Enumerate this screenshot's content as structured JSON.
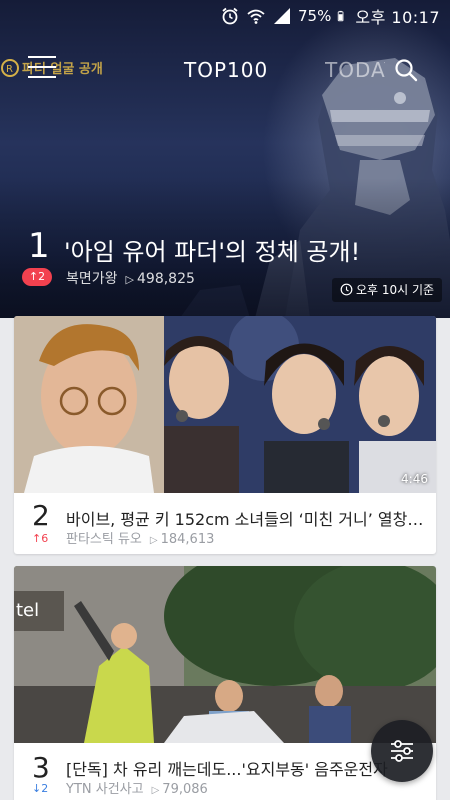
{
  "status_bar": {
    "battery": "75%",
    "time": "오후 10:17",
    "icons": [
      "alarm-icon",
      "wifi-icon",
      "signal-icon",
      "battery-icon"
    ]
  },
  "nav": {
    "brand": "파더 얼굴 공개",
    "tabs": [
      {
        "label": "TOP100",
        "active": true
      },
      {
        "label": "TODAY",
        "active": false
      }
    ],
    "icons": [
      "menu-icon",
      "search-icon"
    ]
  },
  "hero": {
    "rank": "1",
    "title": "'아임 유어 파더'의 정체 공개!",
    "change": "↑2",
    "program": "복면가왕",
    "views": "498,825",
    "updated": "오후 10시 기준"
  },
  "items": [
    {
      "rank": "2",
      "title": "바이브, 평균 키 152cm 소녀들의 ‘미친 거니’ 열창에 ...",
      "change": "↑6",
      "direction": "up",
      "program": "판타스틱 듀오",
      "views": "184,613",
      "duration": "4:46"
    },
    {
      "rank": "3",
      "title": "[단독] 차 유리 깨는데도...'요지부동' 음주운전자",
      "change": "↓2",
      "direction": "down",
      "program": "YTN 사건사고",
      "views": "79,086"
    }
  ],
  "colors": {
    "accent_up": "#f2414f",
    "accent_down": "#3b7fe0",
    "background": "#e9eaed"
  }
}
